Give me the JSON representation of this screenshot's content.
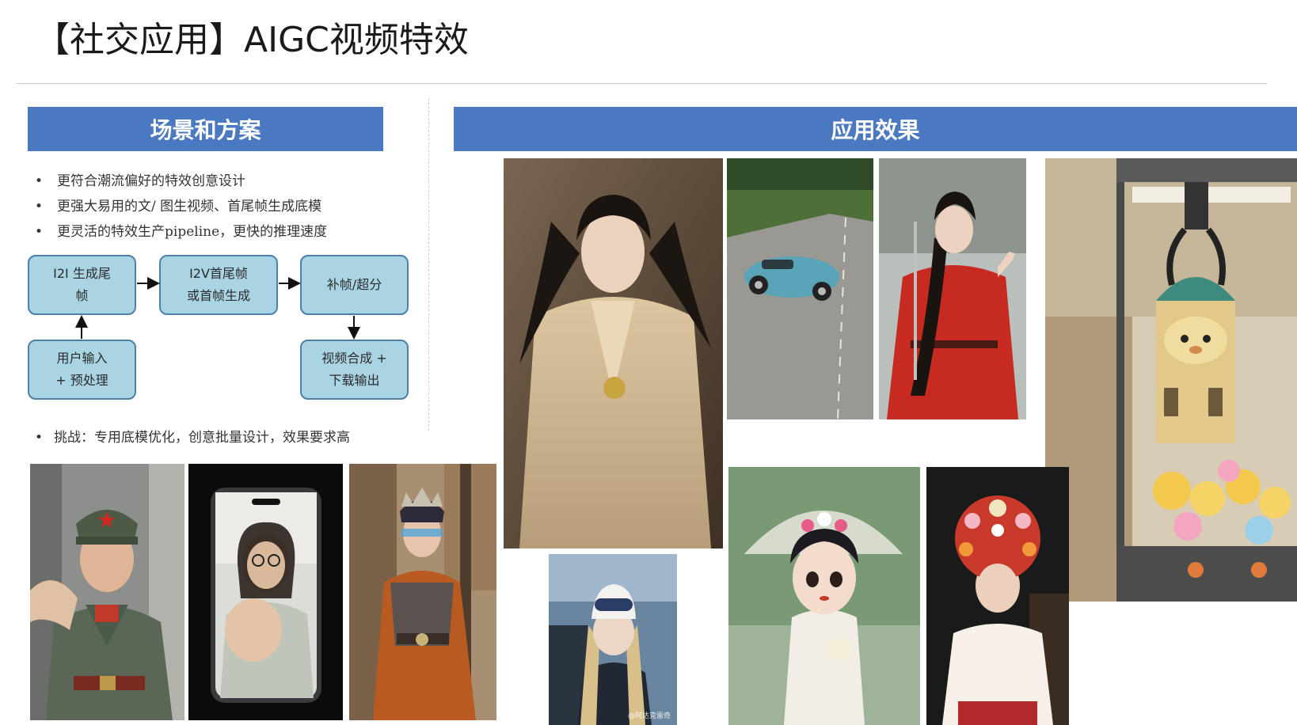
{
  "title": "【社交应用】AIGC视频特效",
  "left_section": {
    "header": "场景和方案",
    "bullets": [
      "更符合潮流偏好的特效创意设计",
      "更强大易用的文/ 图生视频、首尾帧生成底模",
      "更灵活的特效生产pipeline，更快的推理速度"
    ],
    "flow": {
      "i2i": [
        "I2I 生成尾",
        "帧"
      ],
      "i2v": [
        "I2V首尾帧",
        "或首帧生成"
      ],
      "sr": "补帧/超分",
      "input": [
        "用户输入",
        "+ 预处理"
      ],
      "synth": [
        "视频合成 +",
        "下载输出"
      ]
    },
    "challenge": "挑战：专用底模优化，创意批量设计，效果要求高"
  },
  "right_section": {
    "header": "应用效果"
  },
  "photos": {
    "soldier": "portrait of man in green military uniform with red star cap",
    "phone": "phone screen showing woman with glasses reaching toward camera",
    "armor": "person in fantasy armor costume with headdress",
    "hanfu": "woman in golden hanfu robe with long black hair",
    "car": "blue vintage convertible car on road",
    "red_dress": "woman in red hanfu with sword",
    "claw": "claw machine with castle toy and plush ducks",
    "skier": "young woman with ski goggles and beanie",
    "opera": "doll-like girl in opera costume with parasol",
    "flowers": "woman with red floral headdress",
    "watermark": "@阿达克雷奇"
  },
  "colors": {
    "accent_bar": "#4a79c2",
    "flow_box_fill": "#a9d4e3",
    "flow_box_border": "#4e7fa5"
  }
}
